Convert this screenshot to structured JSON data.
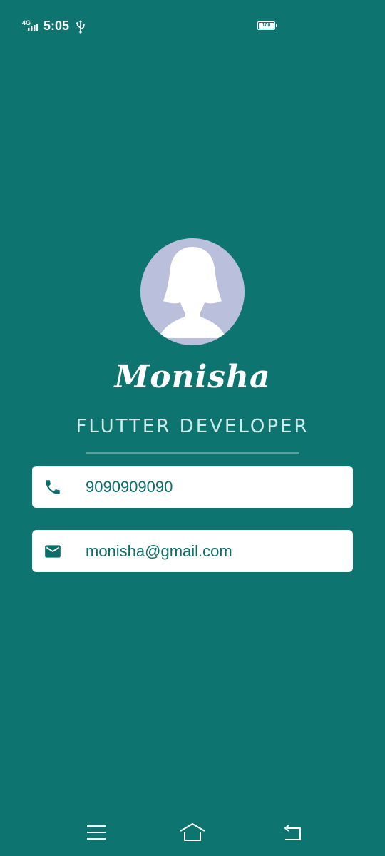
{
  "status_bar": {
    "network": "4G",
    "time": "5:05",
    "battery_level": "100",
    "icons": [
      "signal-icon",
      "usb-icon",
      "battery-icon"
    ]
  },
  "profile": {
    "avatar": "female-silhouette-avatar",
    "name": "Monisha",
    "title": "FLUTTER DEVELOPER"
  },
  "contacts": [
    {
      "icon": "phone-icon",
      "value": "9090909090"
    },
    {
      "icon": "email-icon",
      "value": "monisha@gmail.com"
    }
  ],
  "nav_bar": {
    "buttons": [
      "menu-icon",
      "home-icon",
      "back-icon"
    ]
  },
  "colors": {
    "background": "#0d7470",
    "card": "#ffffff",
    "accent_text": "#0d6d6a",
    "avatar_bg": "#babfdc",
    "divider": "#5aa19d"
  }
}
